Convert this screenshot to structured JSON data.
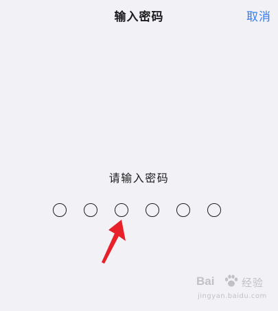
{
  "nav": {
    "title": "输入密码",
    "cancel_label": "取消"
  },
  "prompt": "请输入密码",
  "passcode": {
    "length": 6,
    "entered": 0
  },
  "annotation": {
    "arrow_color": "#e8202a",
    "icon": "red-arrow-icon"
  },
  "watermark": {
    "brand": "Bai",
    "brand_cn": "经验",
    "url": "jingyan.baidu.com",
    "icon": "paw-icon"
  },
  "colors": {
    "background": "#f2f1f6",
    "accent": "#2f7cf6",
    "text": "#1c1c1e"
  }
}
